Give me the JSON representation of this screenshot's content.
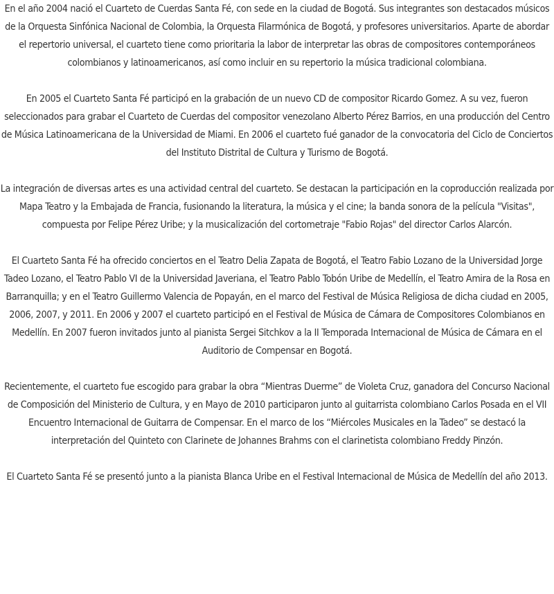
{
  "paragraphs": [
    "En el año 2004 nació el Cuarteto de Cuerdas Santa Fé, con sede en la ciudad de Bogotá. Sus integrantes son destacados músicos de la Orquesta Sinfónica Nacional de Colombia, la Orquesta Filarmónica de Bogotá, y profesores universitarios. Aparte de abordar el repertorio universal, el cuarteto tiene como prioritaria la labor de interpretar las obras de compositores contemporáneos colombianos y latinoamericanos, así como incluir en su repertorio la música tradicional colombiana.",
    "En 2005 el Cuarteto Santa Fé participó en la grabación de un nuevo CD de compositor Ricardo Gomez. A su vez, fueron seleccionados para grabar el Cuarteto de Cuerdas del compositor venezolano Alberto Pérez Barrios, en una producción del Centro de Música Latinoamericana de la Universidad de Miami. En 2006 el cuarteto fué ganador de la convocatoria del Ciclo de Conciertos del Instituto Distrital de Cultura y Turismo de Bogotá.",
    "La integración de diversas artes es una actividad central del cuarteto. Se destacan la participación en la coproducción realizada por Mapa Teatro y la Embajada de Francia, fusionando la literatura, la música y el cine; la banda sonora de la película \"Visitas\", compuesta por Felipe Pérez Uribe; y la musicalización del cortometraje \"Fabio Rojas\" del director Carlos Alarcón.",
    "El Cuarteto Santa Fé ha ofrecido conciertos en el Teatro Delia Zapata de Bogotá, el Teatro Fabio Lozano de la Universidad Jorge Tadeo Lozano, el Teatro Pablo VI de la Universidad Javeriana, el Teatro Pablo Tobón Uribe de Medellín, el Teatro Amira de la Rosa en Barranquilla; y en el Teatro Guillermo Valencia de Popayán, en el marco del Festival de Música Religiosa de dicha ciudad en 2005, 2006, 2007, y 2011. En 2006 y 2007 el cuarteto participó en el Festival de Música de Cámara de Compositores Colombianos en Medellín. En 2007 fueron invitados junto al pianista Sergei Sitchkov a la II Temporada Internacional de Música de Cámara en el Auditorio de Compensar en Bogotá.",
    "Recientemente, el cuarteto fue escogido para grabar la obra “Mientras Duerme” de Violeta Cruz, ganadora del Concurso Nacional de Composición del Ministerio de Cultura, y en Mayo de 2010 participaron junto al guitarrista colombiano Carlos Posada en el VII Encuentro Internacional de Guitarra de Compensar. En el marco de los “Miércoles Musicales en la Tadeo” se destacó la interpretación del Quinteto con Clarinete de Johannes Brahms con el clarinetista colombiano Freddy Pinzón.",
    "El Cuarteto Santa Fé se presentó junto a la pianista Blanca Uribe en el Festival Internacional de Música de Medellín del año 2013."
  ],
  "colors": {
    "text": "#333333",
    "background": "#ffffff"
  }
}
